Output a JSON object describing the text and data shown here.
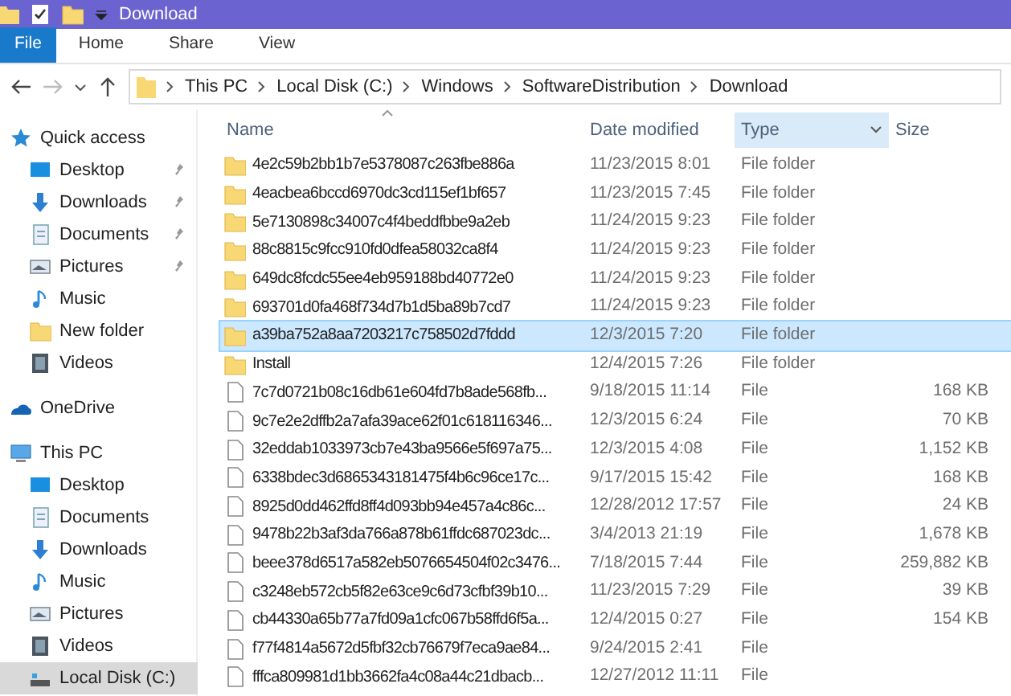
{
  "window": {
    "title": "Download"
  },
  "ribbon_tabs": [
    {
      "label": "File",
      "selected": true
    },
    {
      "label": "Home",
      "selected": false
    },
    {
      "label": "Share",
      "selected": false
    },
    {
      "label": "View",
      "selected": false
    }
  ],
  "address_bar": {
    "path": [
      "This PC",
      "Local Disk (C:)",
      "Windows",
      "SoftwareDistribution",
      "Download"
    ]
  },
  "sidebar": {
    "items": [
      {
        "label": "Quick access",
        "kind": "star",
        "selected": false,
        "children": [
          {
            "label": "Desktop",
            "kind": "desktop",
            "pinned": true,
            "selected": false
          },
          {
            "label": "Downloads",
            "kind": "download",
            "pinned": true,
            "selected": false
          },
          {
            "label": "Documents",
            "kind": "document",
            "pinned": true,
            "selected": false
          },
          {
            "label": "Pictures",
            "kind": "pictures",
            "pinned": true,
            "selected": false
          },
          {
            "label": "Music",
            "kind": "music",
            "pinned": false,
            "selected": false
          },
          {
            "label": "New folder",
            "kind": "folder",
            "pinned": false,
            "selected": false
          },
          {
            "label": "Videos",
            "kind": "videos",
            "pinned": false,
            "selected": false
          }
        ]
      },
      {
        "label": "OneDrive",
        "kind": "cloud",
        "selected": false
      },
      {
        "label": "This PC",
        "kind": "pc",
        "selected": false,
        "children": [
          {
            "label": "Desktop",
            "kind": "desktop",
            "pinned": false,
            "selected": false
          },
          {
            "label": "Documents",
            "kind": "document",
            "pinned": false,
            "selected": false
          },
          {
            "label": "Downloads",
            "kind": "download",
            "pinned": false,
            "selected": false
          },
          {
            "label": "Music",
            "kind": "music",
            "pinned": false,
            "selected": false
          },
          {
            "label": "Pictures",
            "kind": "pictures",
            "pinned": false,
            "selected": false
          },
          {
            "label": "Videos",
            "kind": "videos",
            "pinned": false,
            "selected": false
          },
          {
            "label": "Local Disk (C:)",
            "kind": "disk",
            "pinned": false,
            "selected": true
          }
        ]
      }
    ]
  },
  "table": {
    "columns": [
      {
        "label": "Name",
        "sorted": true
      },
      {
        "label": "Date modified",
        "sorted": false
      },
      {
        "label": "Type",
        "sorted": false
      },
      {
        "label": "Size",
        "sorted": false
      }
    ],
    "rows": [
      {
        "name": "4e2c59b2bb1b7e5378087c263fbe886a",
        "date": "11/23/2015 8:01",
        "type": "File folder",
        "kind": "folder",
        "selected": false
      },
      {
        "name": "4eacbea6bccd6970dc3cd115ef1bf657",
        "date": "11/23/2015 7:45",
        "type": "File folder",
        "kind": "folder",
        "selected": false
      },
      {
        "name": "5e7130898c34007c4f4beddfbbe9a2eb",
        "date": "11/24/2015 9:23",
        "type": "File folder",
        "kind": "folder",
        "selected": false
      },
      {
        "name": "88c8815c9fcc910fd0dfea58032ca8f4",
        "date": "11/24/2015 9:23",
        "type": "File folder",
        "kind": "folder",
        "selected": false
      },
      {
        "name": "649dc8fcdc55ee4eb959188bd40772e0",
        "date": "11/24/2015 9:23",
        "type": "File folder",
        "kind": "folder",
        "selected": false
      },
      {
        "name": "693701d0fa468f734d7b1d5ba89b7cd7",
        "date": "11/24/2015 9:23",
        "type": "File folder",
        "kind": "folder",
        "selected": false
      },
      {
        "name": "a39ba752a8aa7203217c758502d7fddd",
        "date": "12/3/2015 7:20",
        "type": "File folder",
        "kind": "folder",
        "selected": true
      },
      {
        "name": "Install",
        "date": "12/4/2015 7:26",
        "type": "File folder",
        "kind": "folder",
        "selected": false
      },
      {
        "name": "7c7d0721b08c16db61e604fd7b8ade568fb...",
        "date": "9/18/2015 11:14",
        "type": "File",
        "size": "168 KB",
        "kind": "file",
        "selected": false
      },
      {
        "name": "9c7e2e2dffb2a7afa39ace62f01c618116346...",
        "date": "12/3/2015 6:24",
        "type": "File",
        "size": "70 KB",
        "kind": "file",
        "selected": false
      },
      {
        "name": "32eddab1033973cb7e43ba9566e5f697a75...",
        "date": "12/3/2015 4:08",
        "type": "File",
        "size": "1,152 KB",
        "kind": "file",
        "selected": false
      },
      {
        "name": "6338bdec3d6865343181475f4b6c96ce17c...",
        "date": "9/17/2015 15:42",
        "type": "File",
        "size": "168 KB",
        "kind": "file",
        "selected": false
      },
      {
        "name": "8925d0dd462ffd8ff4d093bb94e457a4c86c...",
        "date": "12/28/2012 17:57",
        "type": "File",
        "size": "24 KB",
        "kind": "file",
        "selected": false
      },
      {
        "name": "9478b22b3af3da766a878b61ffdc687023dc...",
        "date": "3/4/2013 21:19",
        "type": "File",
        "size": "1,678 KB",
        "kind": "file",
        "selected": false
      },
      {
        "name": "beee378d6517a582eb5076654504f02c3476...",
        "date": "7/18/2015 7:44",
        "type": "File",
        "size": "259,882 KB",
        "kind": "file",
        "selected": false
      },
      {
        "name": "c3248eb572cb5f82e63ce9c6d73cfbf39b10...",
        "date": "11/23/2015 7:29",
        "type": "File",
        "size": "39 KB",
        "kind": "file",
        "selected": false
      },
      {
        "name": "cb44330a65b77a7fd09a1cfc067b58ffd6f5a...",
        "date": "12/4/2015 0:27",
        "type": "File",
        "size": "154 KB",
        "kind": "file",
        "selected": false
      },
      {
        "name": "f77f4814a5672d5fbf32cb76679f7eca9ae84...",
        "date": "9/24/2015 2:41",
        "type": "File",
        "kind": "file",
        "selected": false
      },
      {
        "name": "fffca809981d1bb3662fa4c08a44c21dbacb...",
        "date": "12/27/2012 11:11",
        "type": "File",
        "kind": "file",
        "selected": false
      }
    ]
  }
}
